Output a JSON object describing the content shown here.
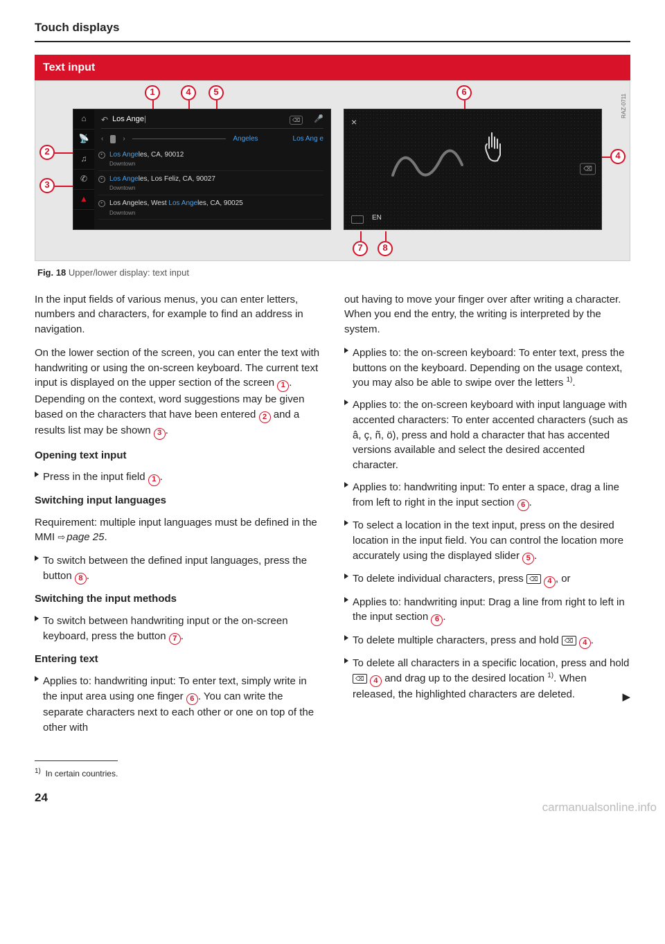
{
  "header": "Touch displays",
  "section_title": "Text input",
  "figure": {
    "caption_label": "Fig. 18",
    "caption_text": "Upper/lower display: text input",
    "side_code": "RAZ-0711",
    "callouts": [
      "1",
      "2",
      "3",
      "4",
      "5",
      "6",
      "7",
      "8"
    ],
    "left_screen": {
      "input_text": "Los Ange",
      "suggestions": [
        "Angeles",
        "Los Ang e"
      ],
      "results": [
        {
          "line1_hl": "Los Ange",
          "line1_rest": "les, CA, 90012",
          "line2": "Downtown"
        },
        {
          "line1_hl": "Los Ange",
          "line1_rest": "les, Los Feliz, CA, 90027",
          "line2": "Downtown"
        },
        {
          "line1_pre": "Los Angeles, West ",
          "line1_hl": "Los Ange",
          "line1_rest": "les, CA, 90025",
          "line2": "Downtown"
        }
      ]
    },
    "right_screen": {
      "close": "×",
      "lang": "EN",
      "delete": "⌫"
    }
  },
  "intro1": "In the input fields of various menus, you can enter letters, numbers and characters, for example to find an address in navigation.",
  "intro2_a": "On the lower section of the screen, you can enter the text with handwriting or using the on-screen keyboard. The current text input is displayed on the upper section of the screen ",
  "intro2_b": ". Depending on the context, word suggestions may be given based on the characters that have been entered ",
  "intro2_c": " and a results list may be shown ",
  "intro2_d": ".",
  "h_open": "Opening text input",
  "b_open_a": "Press in the input field ",
  "b_open_b": ".",
  "h_lang": "Switching input languages",
  "p_lang_a": "Requirement: multiple input languages must be defined in the MMI ",
  "p_lang_link": "page 25",
  "p_lang_b": ".",
  "b_lang_a": "To switch between the defined input languages, press the button ",
  "b_lang_b": ".",
  "h_method": "Switching the input methods",
  "b_method_a": "To switch between handwriting input or the on-screen keyboard, press the button ",
  "b_method_b": ".",
  "h_enter": "Entering text",
  "b_hw_a": "Applies to: handwriting input: To enter text, simply write in the input area using one finger ",
  "b_hw_b": ". You can write the separate characters next to each other or one on top of the other with",
  "r_cont": "out having to move your finger over after writing a character. When you end the entry, the writing is interpreted by the system.",
  "r_kb_a": "Applies to: the on-screen keyboard: To enter text, press the buttons on the keyboard. Depending on the usage context, you may also be able to swipe over the letters ",
  "r_kb_b": ".",
  "r_acc": "Applies to: the on-screen keyboard with input language with accented characters: To enter accented characters (such as â, ç, ñ, ö), press and hold a character that has accented versions available and select the desired accented character.",
  "r_space_a": "Applies to: handwriting input: To enter a space, drag a line from left to right in the input section ",
  "r_space_b": ".",
  "r_loc_a": "To select a location in the text input, press on the desired location in the input field. You can control the location more accurately using the displayed slider ",
  "r_loc_b": ".",
  "r_del1_a": "To delete individual characters, press ",
  "r_del1_b": ", or",
  "r_del2_a": "Applies to: handwriting input: Drag a line from right to left in the input section ",
  "r_del2_b": ".",
  "r_del3_a": "To delete multiple characters, press and hold ",
  "r_del3_b": ".",
  "r_del4_a": "To delete all characters in a specific location, press and hold ",
  "r_del4_b": " and drag up to the desired location ",
  "r_del4_c": ". When released, the highlighted characters are deleted.",
  "sup1": "1)",
  "footnote": "In certain countries.",
  "pagenum": "24",
  "watermark": "carmanualsonline.info"
}
